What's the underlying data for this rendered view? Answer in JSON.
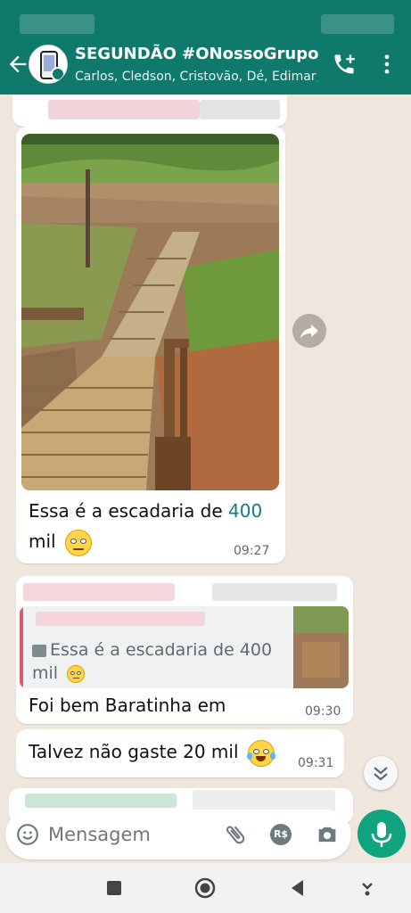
{
  "header": {
    "title": "SEGUNDÃO #ONossoGrupo",
    "subtitle": "Carlos, Cledson, Cristovão, Dé, Edimar,..."
  },
  "messages": [
    {
      "type": "image",
      "caption_prefix": "Essa é a escadaria de ",
      "caption_number": "400",
      "caption_suffix": "mil",
      "emoji": "face-with-rolling-eyes",
      "time": "09:27"
    },
    {
      "type": "reply",
      "quoted_text_line1": "Essa é a escadaria de 400",
      "quoted_text_line2": "mil",
      "text": "Foi bem Baratinha em",
      "time": "09:30"
    },
    {
      "type": "text",
      "text": "Talvez não gaste 20 mil",
      "emoji": "face-with-tears-of-joy",
      "time": "09:31"
    }
  ],
  "composer": {
    "placeholder": "Mensagem",
    "payment_label": "R$"
  },
  "colors": {
    "header": "#0f7a6b",
    "link_number": "#117a8b",
    "mic_button": "#10a37f",
    "quote_bar": "#e05a6d"
  },
  "icons": [
    "back-arrow-icon",
    "add-call-icon",
    "more-vertical-icon",
    "forward-icon",
    "emoji-icon",
    "attach-icon",
    "payment-icon",
    "camera-icon",
    "mic-icon",
    "scroll-down-icon",
    "image-icon"
  ]
}
